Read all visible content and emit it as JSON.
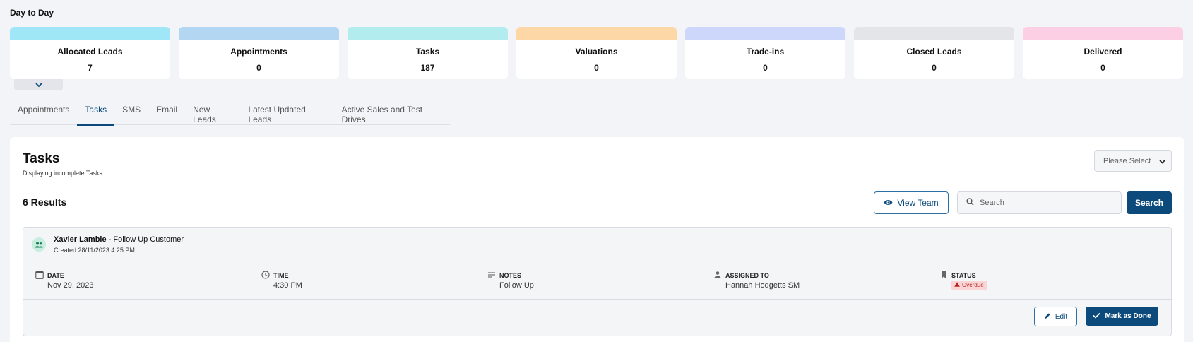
{
  "page": {
    "section_title": "Day to Day"
  },
  "cards": [
    {
      "label": "Allocated Leads",
      "value": "7",
      "color": "#9fe6f7"
    },
    {
      "label": "Appointments",
      "value": "0",
      "color": "#b3d6f3"
    },
    {
      "label": "Tasks",
      "value": "187",
      "color": "#b2ecef"
    },
    {
      "label": "Valuations",
      "value": "0",
      "color": "#fdd7a6"
    },
    {
      "label": "Trade-ins",
      "value": "0",
      "color": "#ccd7fb"
    },
    {
      "label": "Closed Leads",
      "value": "0",
      "color": "#e4e5e8"
    },
    {
      "label": "Delivered",
      "value": "0",
      "color": "#fccfe4"
    }
  ],
  "tabs": [
    {
      "label": "Appointments",
      "active": false
    },
    {
      "label": "Tasks",
      "active": true
    },
    {
      "label": "SMS",
      "active": false
    },
    {
      "label": "Email",
      "active": false
    },
    {
      "label": "New Leads",
      "active": false
    },
    {
      "label": "Latest Updated Leads",
      "active": false
    },
    {
      "label": "Active Sales and Test Drives",
      "active": false
    }
  ],
  "panel": {
    "title": "Tasks",
    "subtitle": "Displaying incomplete Tasks.",
    "select_value": "Please Select",
    "results_label": "6 Results",
    "view_team_label": "View Team",
    "search_placeholder": "Search",
    "search_button_label": "Search"
  },
  "task": {
    "customer": "Xavier Lamble",
    "separator": " - ",
    "task_type": "Follow Up Customer",
    "created": "Created 28/11/2023 4:25 PM",
    "date_label": "DATE",
    "date_value": "Nov 29, 2023",
    "time_label": "TIME",
    "time_value": "4:30 PM",
    "notes_label": "NOTES",
    "notes_value": "Follow Up",
    "assigned_label": "ASSIGNED TO",
    "assigned_value": "Hannah Hodgetts SM",
    "status_label": "STATUS",
    "status_value": "Overdue",
    "edit_label": "Edit",
    "done_label": "Mark as Done"
  },
  "colors": {
    "accent": "#0b4a7a",
    "overdue_bg": "#fbd5d5",
    "overdue_text": "#b3261e"
  },
  "icons": [
    "chevron-down-icon",
    "eye-icon",
    "search-icon",
    "team-icon",
    "calendar-icon",
    "clock-icon",
    "notes-icon",
    "person-icon",
    "bookmark-icon",
    "warning-icon",
    "pencil-icon",
    "check-icon"
  ]
}
